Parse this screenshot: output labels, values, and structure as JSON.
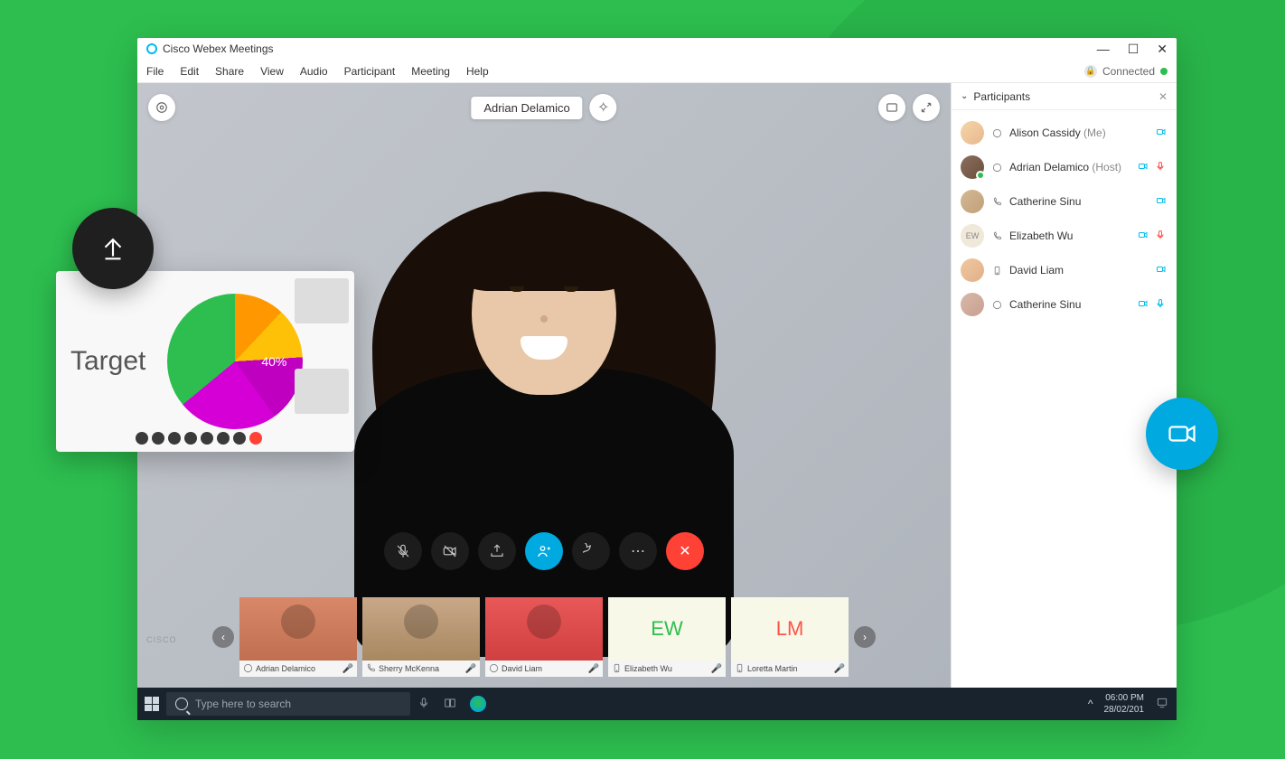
{
  "titlebar": {
    "app_name": "Cisco Webex Meetings"
  },
  "menubar": {
    "items": [
      "File",
      "Edit",
      "Share",
      "View",
      "Audio",
      "Participant",
      "Meeting",
      "Help"
    ],
    "status": "Connected"
  },
  "speaker": {
    "name": "Adrian Delamico"
  },
  "participants_panel": {
    "title": "Participants",
    "items": [
      {
        "name": "Alison Cassidy",
        "suffix": "(Me)",
        "type": "webex",
        "cam": true,
        "mic": "none",
        "avatar": "a1"
      },
      {
        "name": "Adrian Delamico",
        "suffix": "(Host)",
        "type": "webex",
        "cam": true,
        "mic": "red",
        "avatar": "a2",
        "presence": true
      },
      {
        "name": "Catherine Sinu",
        "suffix": "",
        "type": "phone",
        "cam": true,
        "mic": "none",
        "avatar": "a3"
      },
      {
        "name": "Elizabeth Wu",
        "suffix": "",
        "type": "phone",
        "cam": true,
        "mic": "red",
        "avatar": "a4",
        "initials": "EW"
      },
      {
        "name": "David Liam",
        "suffix": "",
        "type": "mobile",
        "cam": true,
        "mic": "none",
        "avatar": "a5"
      },
      {
        "name": "Catherine Sinu",
        "suffix": "",
        "type": "webex",
        "cam": true,
        "mic": "blue",
        "avatar": "a6"
      }
    ]
  },
  "filmstrip": {
    "items": [
      {
        "name": "Adrian Delamico",
        "type": "webex",
        "initials": "",
        "mic": "red",
        "cls": "t1"
      },
      {
        "name": "Sherry McKenna",
        "type": "phone",
        "initials": "",
        "mic": "red",
        "cls": "t2"
      },
      {
        "name": "David Liam",
        "type": "webex",
        "initials": "",
        "mic": "red",
        "cls": "t3"
      },
      {
        "name": "Elizabeth Wu",
        "type": "mobile",
        "initials": "EW",
        "mic": "red",
        "cls": "t4"
      },
      {
        "name": "Loretta Martin",
        "type": "mobile",
        "initials": "LM",
        "mic": "red",
        "cls": "t5"
      }
    ]
  },
  "taskbar": {
    "search_placeholder": "Type here to search",
    "time": "06:00 PM",
    "date": "28/02/201"
  },
  "share_card": {
    "label": "Target"
  },
  "watermark": "CISCO",
  "chart_data": {
    "type": "pie",
    "title": "Target",
    "slices": [
      {
        "label": "",
        "value": 12,
        "color": "#ff9800"
      },
      {
        "label": "",
        "value": 12,
        "color": "#ffc107"
      },
      {
        "label": "",
        "value": 16,
        "color": "#c000c0"
      },
      {
        "label": "40%",
        "value": 24,
        "color": "#d500d5"
      },
      {
        "label": "",
        "value": 36,
        "color": "#2dbe4f"
      }
    ]
  }
}
